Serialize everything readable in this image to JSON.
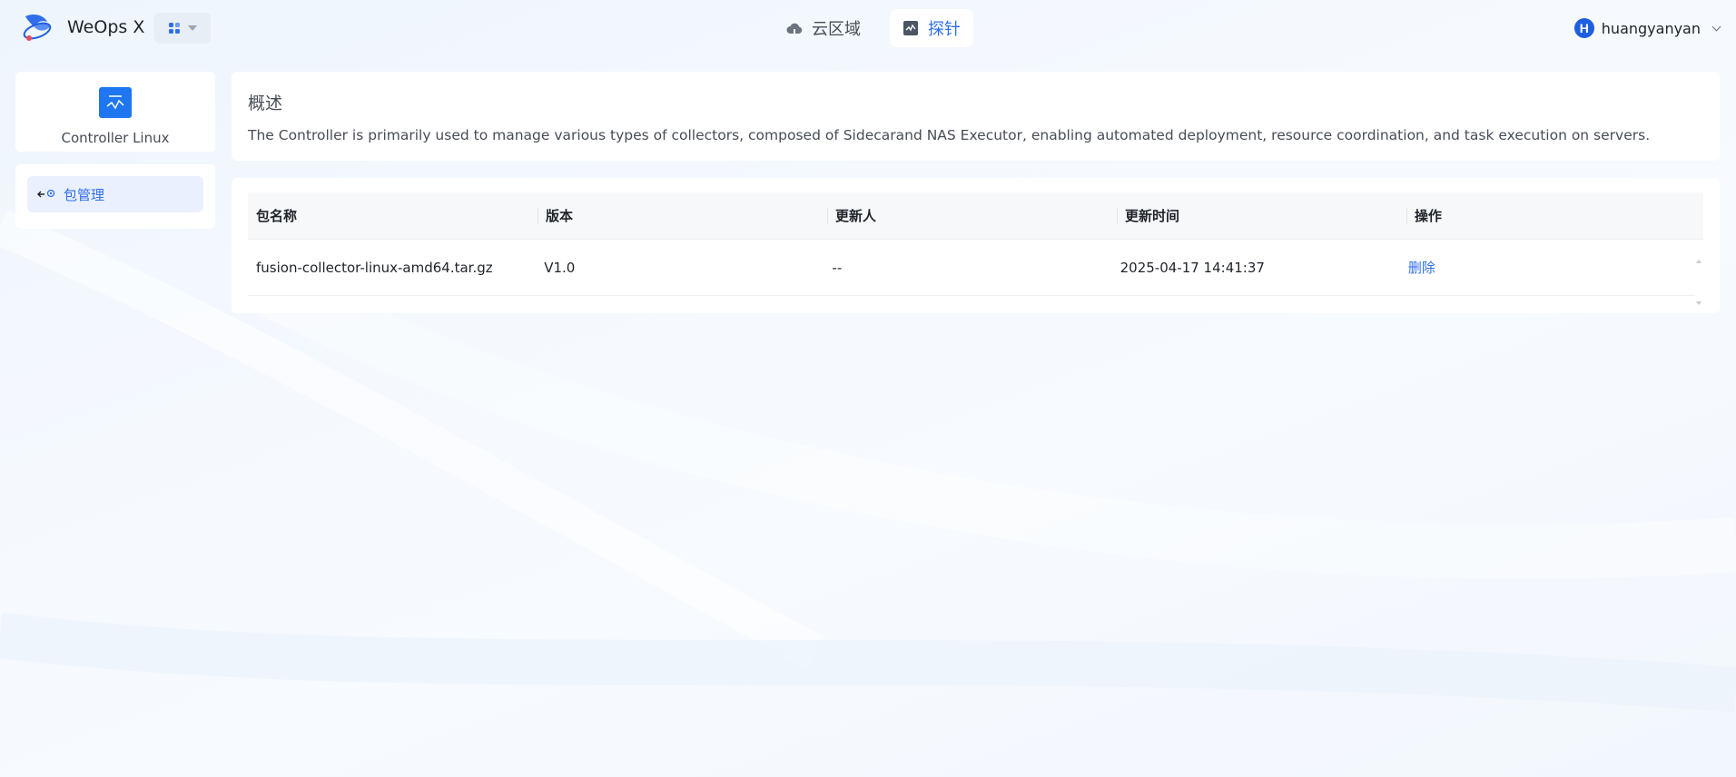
{
  "app": {
    "name": "WeOps X"
  },
  "nav": [
    {
      "label": "云区域",
      "icon": "cloud-icon",
      "active": false
    },
    {
      "label": "探针",
      "icon": "probe-icon",
      "active": true
    }
  ],
  "user": {
    "avatar_letter": "H",
    "name": "huangyanyan"
  },
  "sidebar": {
    "controller_name": "Controller Linux",
    "menu": [
      {
        "label": "包管理",
        "icon": "package-icon"
      }
    ]
  },
  "overview": {
    "title": "概述",
    "description": "The Controller is primarily used to manage various types of collectors, composed of Sidecarand NAS Executor, enabling automated deployment, resource coordination, and task execution on servers."
  },
  "table": {
    "columns": [
      "包名称",
      "版本",
      "更新人",
      "更新时间",
      "操作"
    ],
    "rows": [
      {
        "name": "fusion-collector-linux-amd64.tar.gz",
        "version": "V1.0",
        "updater": "--",
        "updated_at": "2025-04-17 14:41:37",
        "action": "删除"
      }
    ]
  },
  "colors": {
    "accent": "#2f6feb",
    "brand": "#1e76f0"
  }
}
